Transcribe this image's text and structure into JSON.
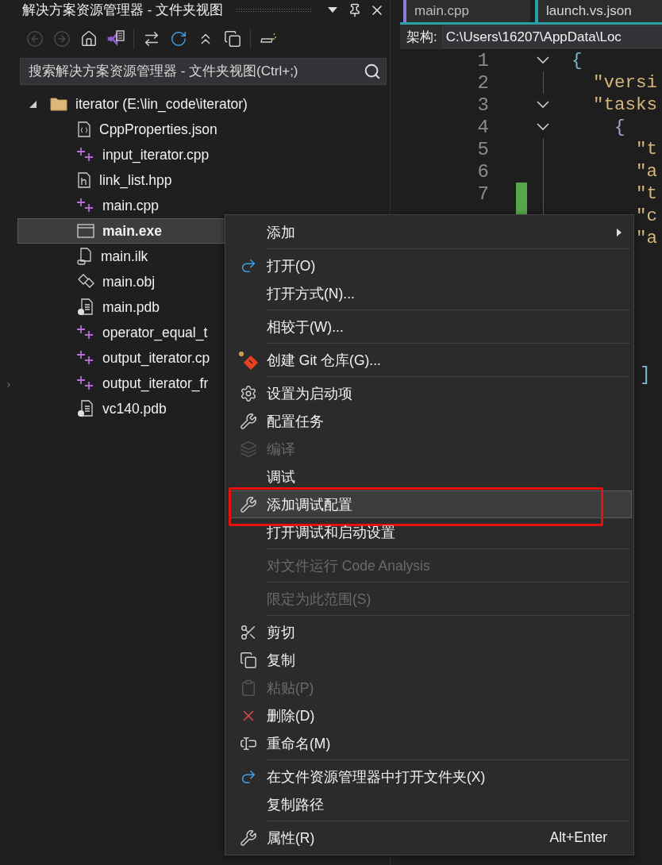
{
  "explorer": {
    "title": "解决方案资源管理器 - 文件夹视图",
    "toolbar": [
      {
        "kind": "back",
        "disabled": true
      },
      {
        "kind": "forward",
        "disabled": true
      },
      {
        "kind": "home"
      },
      {
        "kind": "solution"
      },
      {
        "kind": "separator"
      },
      {
        "kind": "sync"
      },
      {
        "kind": "refresh"
      },
      {
        "kind": "collapse"
      },
      {
        "kind": "copy"
      },
      {
        "kind": "separator"
      },
      {
        "kind": "properties"
      }
    ],
    "search": {
      "placeholder": "搜索解决方案资源管理器 - 文件夹视图(Ctrl+;)"
    },
    "tree": [
      {
        "label": "iterator (E:\\lin_code\\iterator)",
        "kind": "folder",
        "expanded": true,
        "selected": false,
        "children": [
          {
            "label": "CppProperties.json",
            "kind": "json",
            "selected": false
          },
          {
            "label": "input_iterator.cpp",
            "kind": "cpp",
            "selected": false
          },
          {
            "label": "link_list.hpp",
            "kind": "header",
            "selected": false
          },
          {
            "label": "main.cpp",
            "kind": "cpp",
            "selected": false
          },
          {
            "label": "main.exe",
            "kind": "exe",
            "selected": true
          },
          {
            "label": "main.ilk",
            "kind": "ilk",
            "selected": false
          },
          {
            "label": "main.obj",
            "kind": "obj",
            "selected": false
          },
          {
            "label": "main.pdb",
            "kind": "pdb",
            "selected": false
          },
          {
            "label": "operator_equal_t",
            "kind": "cpp",
            "selected": false
          },
          {
            "label": "output_iterator.cp",
            "kind": "cpp",
            "selected": false
          },
          {
            "label": "output_iterator_fr",
            "kind": "cpp",
            "selected": false
          },
          {
            "label": "vc140.pdb",
            "kind": "pdb",
            "selected": false
          }
        ]
      }
    ]
  },
  "editor": {
    "tabs": [
      {
        "label": "main.cpp",
        "selected": false
      },
      {
        "label": "launch.vs.json",
        "selected": true
      }
    ],
    "arch_label": "架构:",
    "arch_value": "C:\\Users\\16207\\AppData\\Loc",
    "lines": [
      {
        "number": "1",
        "text": "{",
        "kind": "brace",
        "fold": true,
        "changed": false
      },
      {
        "number": "2",
        "text": "  \"versi",
        "kind": "string",
        "fold": false,
        "changed": false
      },
      {
        "number": "3",
        "text": "  \"tasks",
        "kind": "string",
        "fold": true,
        "changed": false
      },
      {
        "number": "4",
        "text": "    {",
        "kind": "inner_brace",
        "fold": true,
        "changed": false
      },
      {
        "number": "5",
        "text": "      \"t",
        "kind": "string",
        "fold": false,
        "changed": false
      },
      {
        "number": "6",
        "text": "      \"a",
        "kind": "string",
        "fold": false,
        "changed": false
      },
      {
        "number": "7",
        "text": "      \"t",
        "kind": "string",
        "fold": false,
        "changed": true
      },
      {
        "text": "      \"c",
        "kind": "string",
        "fold": false,
        "changed": true
      },
      {
        "text": "      \"a",
        "kind": "string"
      }
    ],
    "tail": "]"
  },
  "context_menu": {
    "items": [
      {
        "kind": "plain",
        "label": "添加",
        "submenu": true,
        "disabled": false,
        "selected": false
      },
      {
        "kind": "separator"
      },
      {
        "kind": "open",
        "label": "打开(O)",
        "disabled": false,
        "selected": false
      },
      {
        "kind": "plain",
        "label": "打开方式(N)...",
        "disabled": false,
        "selected": false
      },
      {
        "kind": "separator"
      },
      {
        "kind": "plain",
        "label": "相较于(W)...",
        "disabled": false,
        "selected": false
      },
      {
        "kind": "separator"
      },
      {
        "kind": "git",
        "label": "创建 Git 仓库(G)...",
        "disabled": false,
        "selected": false
      },
      {
        "kind": "separator"
      },
      {
        "kind": "gear",
        "label": "设置为启动项",
        "disabled": false,
        "selected": false
      },
      {
        "kind": "wrench",
        "label": "配置任务",
        "disabled": false,
        "selected": false
      },
      {
        "kind": "build",
        "label": "编译",
        "disabled": true,
        "selected": false
      },
      {
        "kind": "plain",
        "label": "调试",
        "disabled": false,
        "selected": false
      },
      {
        "kind": "wrench",
        "label": "添加调试配置",
        "disabled": false,
        "selected": true,
        "annotated": true
      },
      {
        "kind": "plain",
        "label": "打开调试和启动设置",
        "disabled": false,
        "selected": false
      },
      {
        "kind": "separator"
      },
      {
        "kind": "plain",
        "label": "对文件运行 Code Analysis",
        "disabled": true,
        "selected": false
      },
      {
        "kind": "separator"
      },
      {
        "kind": "plain",
        "label": "限定为此范围(S)",
        "disabled": true,
        "selected": false
      },
      {
        "kind": "separator"
      },
      {
        "kind": "cut",
        "label": "剪切",
        "disabled": false,
        "selected": false
      },
      {
        "kind": "copy",
        "label": "复制",
        "disabled": false,
        "selected": false
      },
      {
        "kind": "paste",
        "label": "粘贴(P)",
        "disabled": true,
        "selected": false
      },
      {
        "kind": "delete",
        "label": "删除(D)",
        "disabled": false,
        "selected": false
      },
      {
        "kind": "rename",
        "label": "重命名(M)",
        "disabled": false,
        "selected": false
      },
      {
        "kind": "separator"
      },
      {
        "kind": "open",
        "label": "在文件资源管理器中打开文件夹(X)",
        "disabled": false,
        "selected": false
      },
      {
        "kind": "plain",
        "label": "复制路径",
        "disabled": false,
        "selected": false
      },
      {
        "kind": "separator"
      },
      {
        "kind": "wrench",
        "label": "属性(R)",
        "shortcut": "Alt+Enter",
        "disabled": false,
        "selected": false
      }
    ]
  }
}
